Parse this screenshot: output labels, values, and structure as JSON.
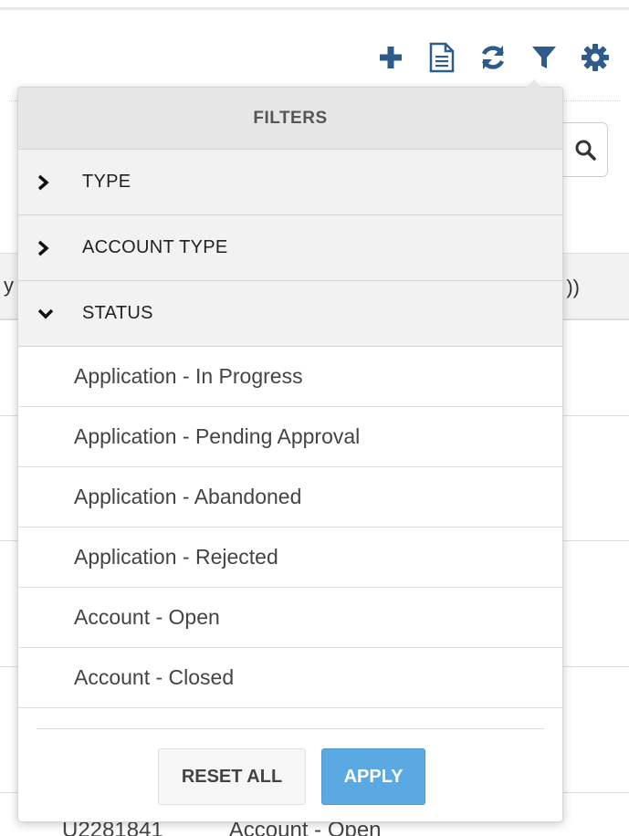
{
  "toolbar": {
    "icons": [
      "add-icon",
      "document-icon",
      "refresh-icon",
      "filter-icon",
      "gear-icon"
    ],
    "icon_color": "#2d5c8c"
  },
  "background": {
    "header_left_fragment": "y",
    "header_right_fragment": "))",
    "row_cells": [
      "U2281841",
      "Account - Open"
    ]
  },
  "filters": {
    "title": "FILTERS",
    "sections": [
      {
        "label": "TYPE",
        "expanded": false
      },
      {
        "label": "ACCOUNT TYPE",
        "expanded": false
      },
      {
        "label": "STATUS",
        "expanded": true
      }
    ],
    "status_options": [
      "Application - In Progress",
      "Application - Pending Approval",
      "Application - Abandoned",
      "Application - Rejected",
      "Account - Open",
      "Account - Closed"
    ],
    "reset_label": "RESET ALL",
    "apply_label": "APPLY",
    "apply_color": "#5aa9e3"
  }
}
